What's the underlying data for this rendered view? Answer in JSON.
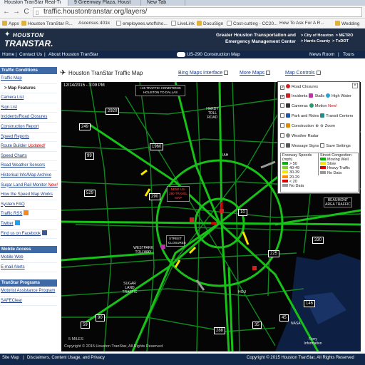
{
  "browser": {
    "tabs": [
      "Houston TranStar Real-Ti",
      "9 Greenway Plaza, Houst",
      "New Tab"
    ],
    "url": "traffic.houstontranstar.org/layers/",
    "bookmarks": [
      "Apps",
      "Houston TranStar R...",
      "Ascensus 401k",
      "employees.wtoffsho...",
      "LiveLink",
      "DocuSign",
      "Cost-cutting - CC20...",
      "How To Ask For A R...",
      "Wedding"
    ]
  },
  "banner": {
    "logo_top": "HOUSTON",
    "logo_main": "TRANSTAR.",
    "org_line1": "Greater Houston Transportation and",
    "org_line2": "Emergency Management Center",
    "partners": [
      "> City of Houston",
      "> METRO",
      "> Harris County",
      "> TxDOT"
    ]
  },
  "topnav": {
    "left": [
      "Home",
      "Contact Us",
      "About Houston TranStar"
    ],
    "center": "US-290 Construction Map",
    "right": [
      "News Room",
      "Tours"
    ]
  },
  "sidebar": {
    "traffic_conditions": {
      "heading": "Traffic Conditions",
      "items": [
        {
          "label": "Traffic Map",
          "style": "link"
        },
        {
          "label": "> Map Features",
          "style": "bold"
        },
        {
          "label": "Camera List",
          "style": "link"
        },
        {
          "label": "Sign List",
          "style": "link"
        },
        {
          "label": "Incidents/Road Closures",
          "style": "link"
        },
        {
          "label": "Construction Report",
          "style": "link"
        },
        {
          "label": "Speed Reports",
          "style": "link"
        },
        {
          "label": "Route Builder",
          "style": "link",
          "badge": "Updated!"
        },
        {
          "label": "Speed Charts",
          "style": "link"
        },
        {
          "label": "Road Weather Sensors",
          "style": "link"
        },
        {
          "label": "Historical Info/Map Archive",
          "style": "link"
        },
        {
          "label": "Sugar Land Rail Monitor",
          "style": "link",
          "badge": "New!"
        },
        {
          "label": "How the Speed Map Works",
          "style": "link"
        },
        {
          "label": "System FAQ",
          "style": "link"
        },
        {
          "label": "Traffic RSS",
          "style": "link"
        },
        {
          "label": "Twitter",
          "style": "link"
        },
        {
          "label": "Find us on Facebook",
          "style": "link"
        }
      ]
    },
    "mobile_access": {
      "heading": "Mobile Access",
      "items": [
        "Mobile Web",
        "E-mail Alerts"
      ]
    },
    "transtar_programs": {
      "heading": "TranStar Programs",
      "items": [
        "Motorist Assistance Program",
        "SAFEClear"
      ]
    }
  },
  "map_header": {
    "title": "Houston TranStar Traffic Map",
    "links": [
      "Bing Maps Interface",
      "More Maps",
      "Map Controls"
    ]
  },
  "map": {
    "timestamp": "12/14/2015 - 3:09 PM",
    "copyright": "Copyright © 2015 Houston TranStar, All Rights Reserved",
    "scale": "5 MILES",
    "highway_signs": [
      "2920",
      "249",
      "1960",
      "99",
      "529",
      "290",
      "330",
      "225",
      "146",
      "288",
      "35",
      "59",
      "90",
      "45",
      "10"
    ],
    "labels": [
      "HARDY TOLL ROAD",
      "IAH",
      "WESTPARK TOLLWAY",
      "SUGAR LAND TRAFFIC",
      "HOU",
      "BEAUMONT AREA TRAFFIC",
      "Ferry Information",
      "NASA"
    ],
    "callouts": [
      "I-45 TRAFFIC CONDITIONS HOUSTON TO DALLAS",
      "NEW! US-290 TRAVEL MAP",
      "STREET CLOSURES"
    ]
  },
  "controls": {
    "rows": [
      {
        "checked": true,
        "icon_color": "#cc2222",
        "label": "Road Closures"
      },
      {
        "checked": true,
        "icon_color": "#cc2222",
        "label": "Incidents",
        "extra": [
          "Stalls",
          "High Water"
        ]
      },
      {
        "checked": false,
        "icon_color": "#333333",
        "label": "Cameras",
        "extra": [
          "Motion"
        ],
        "badge": "New!"
      },
      {
        "checked": false,
        "icon_color": "#2255aa",
        "label": "Park and Rides",
        "extra": [
          "Transit Centers"
        ]
      },
      {
        "checked": false,
        "icon_color": "#e08a00",
        "label": "Construction",
        "extra": [
          "Zoom"
        ]
      },
      {
        "checked": false,
        "icon_color": "#888888",
        "label": "Weather Radar"
      },
      {
        "checked": false,
        "icon_color": "#555555",
        "label": "Message Signs",
        "extra": [
          "Save Settings"
        ]
      }
    ],
    "speed_legend": {
      "title": "Freeway Speeds (mph)",
      "items": [
        {
          "label": "> 50",
          "color": "#00b400"
        },
        {
          "label": "40-49",
          "color": "#7ed321"
        },
        {
          "label": "30-39",
          "color": "#f5e400"
        },
        {
          "label": "20-29",
          "color": "#ff8c00"
        },
        {
          "label": "< 20",
          "color": "#e00000"
        },
        {
          "label": "No Data",
          "color": "#9a9a9a"
        }
      ]
    },
    "congestion_legend": {
      "title": "Street Congestion",
      "items": [
        {
          "label": "Moving Well",
          "color": "#00b400"
        },
        {
          "label": "Slow",
          "color": "#f5e400"
        },
        {
          "label": "Heavy Traffic",
          "color": "#e00000"
        },
        {
          "label": "No Data",
          "color": "#9a9a9a"
        }
      ]
    }
  },
  "footer": {
    "left": [
      "Site Map",
      "Disclaimers, Content Usage, and Privacy"
    ],
    "right": "Copyright © 2015 Houston TranStar, All Rights Reserved"
  }
}
